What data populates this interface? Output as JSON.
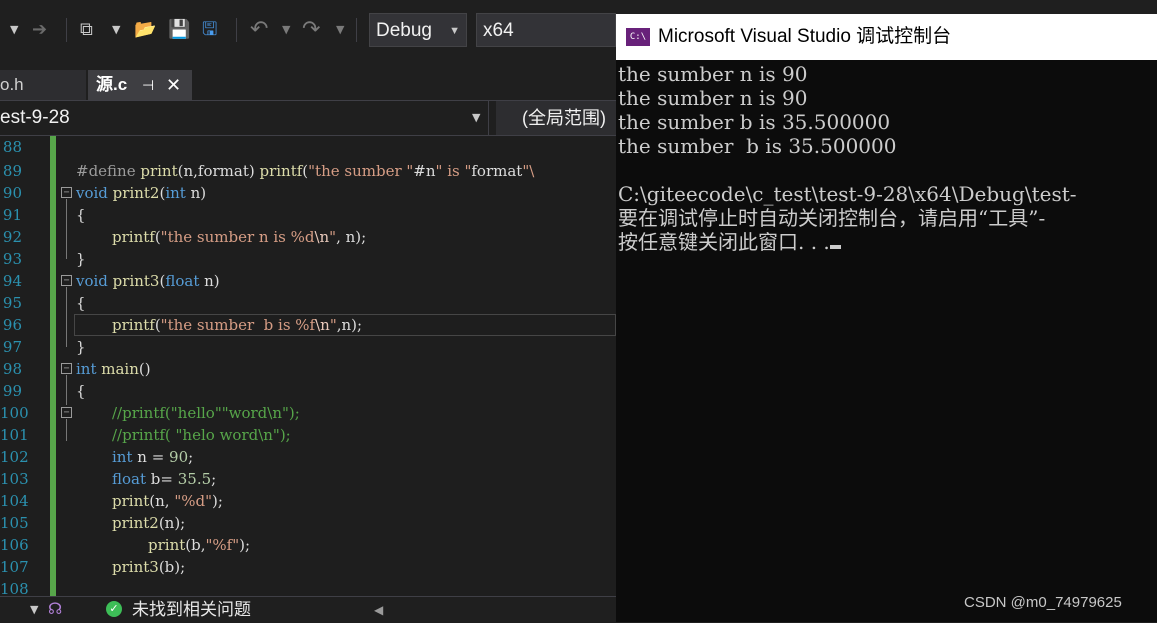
{
  "toolbar": {
    "config": "Debug",
    "platform": "x64"
  },
  "tabs": [
    {
      "label": "o.h"
    },
    {
      "label": "源.c"
    }
  ],
  "navbar": {
    "project": "est-9-28",
    "scope": "(全局范围)"
  },
  "editor": {
    "lines": [
      {
        "num": "88"
      },
      {
        "num": "89"
      },
      {
        "num": "90"
      },
      {
        "num": "91"
      },
      {
        "num": "92"
      },
      {
        "num": "93"
      },
      {
        "num": "94"
      },
      {
        "num": "95"
      },
      {
        "num": "96"
      },
      {
        "num": "97"
      },
      {
        "num": "98"
      },
      {
        "num": "99"
      },
      {
        "num": "100"
      },
      {
        "num": "101"
      },
      {
        "num": "102"
      },
      {
        "num": "103"
      },
      {
        "num": "104"
      },
      {
        "num": "105"
      },
      {
        "num": "106"
      },
      {
        "num": "107"
      },
      {
        "num": "108"
      }
    ],
    "code": {
      "l89_define": "#define ",
      "l89_print": "print",
      "l89_args": "(n,format) ",
      "l89_printf": "printf",
      "l89_s1": "\"the sumber \"",
      "l89_mid": "#n",
      "l89_s2": "\" is \"",
      "l89_fmt": "format",
      "l89_s3": "\"\\",
      "l90_void": "void",
      "l90_name": " print2",
      "l90_open": "(",
      "l90_int": "int",
      "l90_rest": " n)",
      "l91": "{",
      "l92_fn": "printf",
      "l92_open": "(",
      "l92_str": "\"the sumber n is %d",
      "l92_esc": "\\n",
      "l92_end": "\"",
      "l92_rest": ", n);",
      "l93": "}",
      "l94_void": "void",
      "l94_name": " print3",
      "l94_open": "(",
      "l94_float": "float",
      "l94_rest": " n)",
      "l95": "{",
      "l96_fn": "printf",
      "l96_open": "(",
      "l96_str": "\"the sumber  b is %f",
      "l96_esc": "\\n",
      "l96_end": "\"",
      "l96_rest": ",n);",
      "l97": "}",
      "l98_int": "int",
      "l98_main": " main",
      "l98_rest": "()",
      "l99": "{",
      "l100": "//printf(\"hello\"\"word\\n\");",
      "l101": "//printf( \"helo word\\n\");",
      "l102_int": "int",
      "l102_rest": " n = ",
      "l102_num": "90",
      "l102_end": ";",
      "l103_float": "float",
      "l103_rest": " b= ",
      "l103_num": "35.5",
      "l103_end": ";",
      "l104_fn": "print",
      "l104_open": "(n, ",
      "l104_str": "\"%d\"",
      "l104_end": ");",
      "l105_fn": "print2",
      "l105_rest": "(n);",
      "l106_fn": "print",
      "l106_open": "(b,",
      "l106_str": "\"%f\"",
      "l106_end": ");",
      "l107_fn": "print3",
      "l107_rest": "(b);"
    }
  },
  "status": {
    "message": "未找到相关问题"
  },
  "console": {
    "title": "Microsoft Visual Studio 调试控制台",
    "lines": [
      "the sumber n is 90",
      "the sumber n is 90",
      "the sumber b is 35.500000",
      "the sumber  b is 35.500000",
      "",
      "C:\\giteecode\\c_test\\test-9-28\\x64\\Debug\\test-",
      "要在调试停止时自动关闭控制台，请启用“工具”-",
      "按任意键关闭此窗口. . ."
    ]
  },
  "watermark": "CSDN @m0_74979625",
  "colors": {
    "keyword": "#569cd6",
    "string": "#d69d85",
    "comment": "#57a64a",
    "function": "#dcdcaa",
    "line_number": "#2b91af"
  }
}
